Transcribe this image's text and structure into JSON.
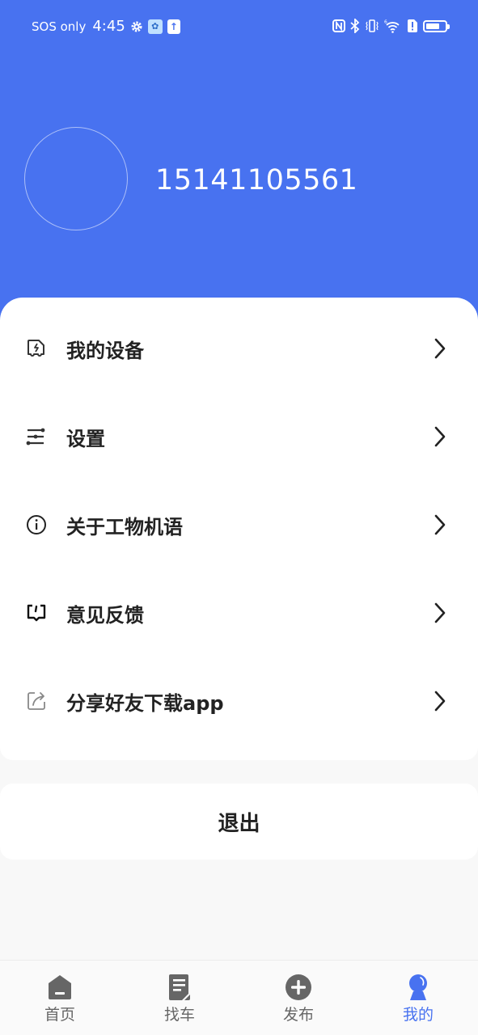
{
  "status_bar": {
    "carrier": "SOS only",
    "time": "4:45",
    "left_icons": [
      "gear-icon",
      "app-notification-icon",
      "upload-icon"
    ],
    "right_icons": [
      "nfc-icon",
      "bluetooth-icon",
      "vibrate-icon",
      "wifi-6-icon",
      "sim-alert-icon",
      "battery-icon"
    ],
    "battery_level_fraction": 0.6
  },
  "profile": {
    "phone": "15141105561"
  },
  "menu": {
    "items": [
      {
        "label": "我的设备",
        "icon": "device-icon"
      },
      {
        "label": "设置",
        "icon": "sliders-icon"
      },
      {
        "label": "关于工物机语",
        "icon": "info-icon"
      },
      {
        "label": "意见反馈",
        "icon": "feedback-icon"
      },
      {
        "label": "分享好友下载app",
        "icon": "share-icon"
      }
    ]
  },
  "logout": {
    "label": "退出"
  },
  "tabbar": {
    "active_index": 3,
    "active_color": "#4872f0",
    "items": [
      {
        "label": "首页",
        "icon": "home-icon"
      },
      {
        "label": "找车",
        "icon": "document-icon"
      },
      {
        "label": "发布",
        "icon": "plus-circle-icon"
      },
      {
        "label": "我的",
        "icon": "person-icon"
      }
    ]
  },
  "colors": {
    "header": "#4872f0",
    "background": "#f8f8f8",
    "text": "#222222"
  }
}
